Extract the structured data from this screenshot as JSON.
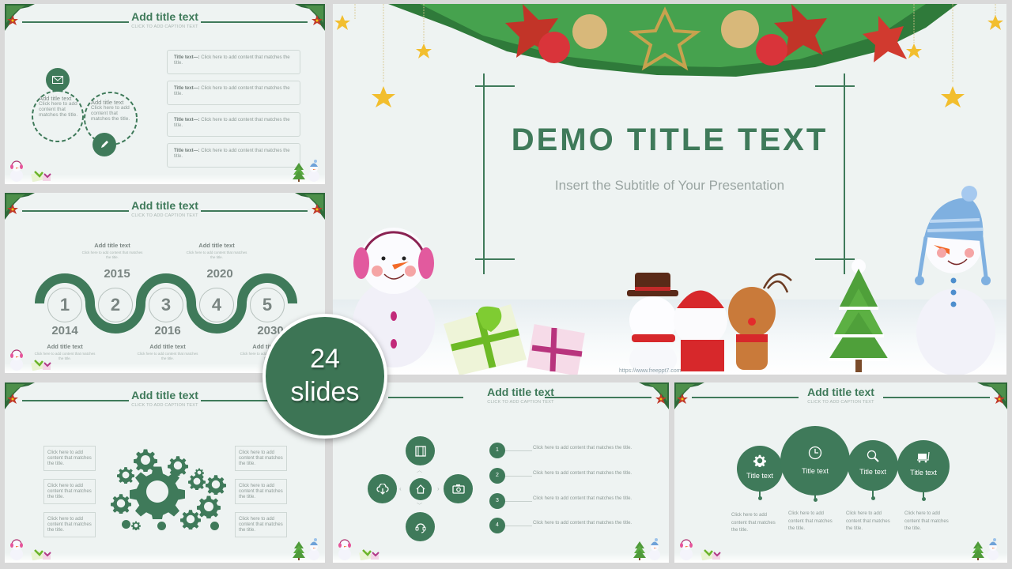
{
  "badge": {
    "count": "24",
    "label": "slides"
  },
  "colors": {
    "accent": "#3f7a5a",
    "background": "#eef3f2",
    "muted_text": "#8d9a96",
    "canvas": "#d9d9d9"
  },
  "common": {
    "slide_title": "Add title text",
    "caption": "CLICK TO ADD CAPTION TEXT"
  },
  "hero": {
    "title": "DEMO TITLE TEXT",
    "subtitle": "Insert the Subtitle of Your Presentation",
    "url": "https://www.freeppt7.com"
  },
  "slide1": {
    "circles": [
      {
        "icon": "envelope-icon",
        "title": "Add title text",
        "body": "Click here to add content that matches the title."
      },
      {
        "icon": "pencil-icon",
        "title": "Add title text",
        "body": "Click here to add content that matches the title."
      }
    ],
    "boxes": [
      {
        "label": "Title text—:",
        "body": "Click here to add content that matches the title."
      },
      {
        "label": "Title text—:",
        "body": "Click here to add content that matches the title."
      },
      {
        "label": "Title text—:",
        "body": "Click here to add content that matches the title."
      },
      {
        "label": "Title text—:",
        "body": "Click here to add content that matches the title."
      }
    ]
  },
  "slide2": {
    "steps": [
      {
        "num": "1",
        "year": "2014",
        "title": "Add title text",
        "desc": "Click here to add content that matches the title."
      },
      {
        "num": "2",
        "year": "2015",
        "title": "Add title text",
        "desc": "Click here to add content that matches the title."
      },
      {
        "num": "3",
        "year": "2016",
        "title": "Add title text",
        "desc": "Click here to add content that matches the title."
      },
      {
        "num": "4",
        "year": "2020",
        "title": "Add title text",
        "desc": "Click here to add content that matches the title."
      },
      {
        "num": "5",
        "year": "2030",
        "title": "Add title text",
        "desc": "Click here to add content that matches the title."
      }
    ]
  },
  "slide3": {
    "callouts_left": [
      "Click here to add content that matches the title.",
      "Click here to add content that matches the title.",
      "Click here to add content that matches the title."
    ],
    "callouts_right": [
      "Click here to add content that matches the title.",
      "Click here to add content that matches the title.",
      "Click here to add content that matches the title."
    ]
  },
  "slide4": {
    "icons": [
      "film-icon",
      "cloud-download-icon",
      "home-icon",
      "camera-icon",
      "headset-icon"
    ],
    "items": [
      {
        "num": "1",
        "text": "Click here to add content that matches the title."
      },
      {
        "num": "2",
        "text": "Click here to add content that matches the title."
      },
      {
        "num": "3",
        "text": "Click here to add content that matches the title."
      },
      {
        "num": "4",
        "text": "Click here to add content that matches the title."
      }
    ]
  },
  "slide5": {
    "bubbles": [
      {
        "icon": "gear-icon",
        "label": "Title text",
        "desc": "Click here to add content that matches the title."
      },
      {
        "icon": "clock-icon",
        "label": "Title text",
        "desc": "Click here to add content that matches the title."
      },
      {
        "icon": "search-chart-icon",
        "label": "Title text",
        "desc": "Click here to add content that matches the title."
      },
      {
        "icon": "luggage-cart-icon",
        "label": "Title text",
        "desc": "Click here to add content that matches the title."
      }
    ]
  }
}
